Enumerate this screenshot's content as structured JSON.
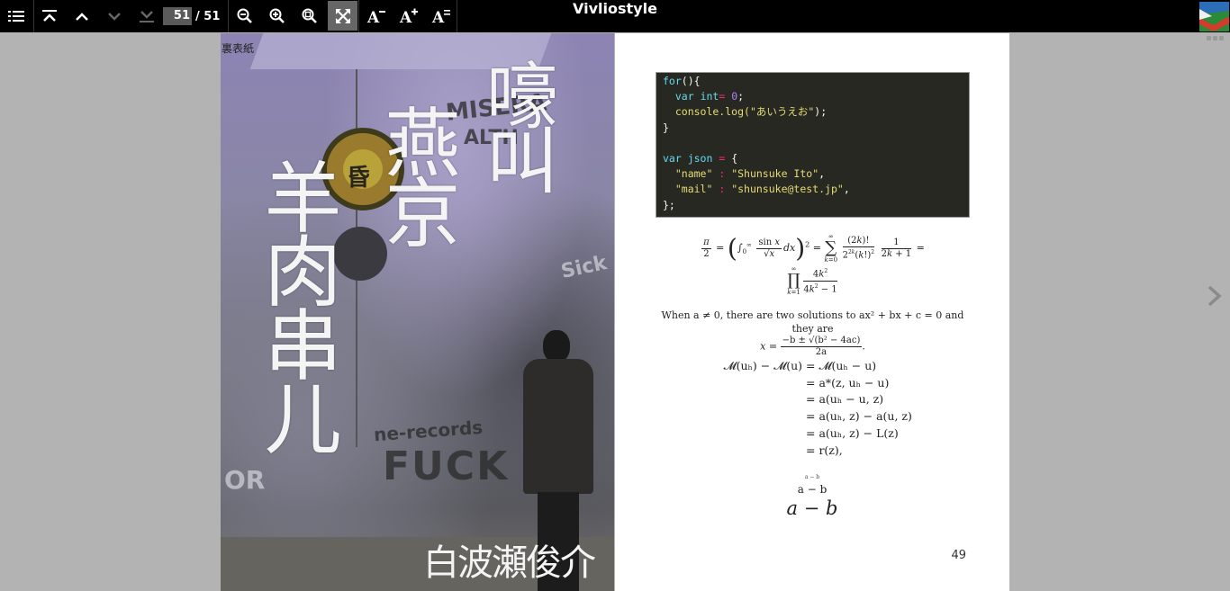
{
  "toolbar": {
    "title": "Vivliostyle",
    "current_page": "51",
    "total_pages": "/ 51",
    "buttons": [
      "table-of-contents",
      "first-page",
      "previous-page",
      "next-page",
      "last-page",
      "zoom-out",
      "zoom-in",
      "zoom-to-actual",
      "fit-to-screen",
      "font-size-decrease",
      "font-size-increase",
      "font-size-reset"
    ],
    "active_button": "fit-to-screen"
  },
  "cover": {
    "label": "裏表紙",
    "title_col1": "嚎叫",
    "title_col2": "燕京",
    "title_col3": "羊肉串儿",
    "author": "白波瀬俊介",
    "graffiti": [
      "MISERA",
      "ALTH",
      "Sick",
      "ne-records",
      "FUCK",
      "OR",
      "昏"
    ]
  },
  "content": {
    "code_lines": [
      [
        {
          "t": "for",
          "c": "kw"
        },
        {
          "t": "(){",
          "c": ""
        }
      ],
      [
        {
          "t": "  ",
          "c": ""
        },
        {
          "t": "var",
          "c": "kw"
        },
        {
          "t": " ",
          "c": ""
        },
        {
          "t": "int",
          "c": "kw"
        },
        {
          "t": "= ",
          "c": "op"
        },
        {
          "t": "0",
          "c": "num"
        },
        {
          "t": ";",
          "c": ""
        }
      ],
      [
        {
          "t": "  console.log(",
          "c": "yel"
        },
        {
          "t": "\"あいうえお\"",
          "c": "str"
        },
        {
          "t": ");",
          "c": ""
        }
      ],
      [
        {
          "t": "}",
          "c": ""
        }
      ],
      [
        {
          "t": "",
          "c": ""
        }
      ],
      [
        {
          "t": "var",
          "c": "kw"
        },
        {
          "t": " json ",
          "c": "kw"
        },
        {
          "t": "=",
          "c": "op"
        },
        {
          "t": " {",
          "c": ""
        }
      ],
      [
        {
          "t": "  ",
          "c": ""
        },
        {
          "t": "\"name\"",
          "c": "str"
        },
        {
          "t": " : ",
          "c": "op"
        },
        {
          "t": "\"Shunsuke Ito\"",
          "c": "str"
        },
        {
          "t": ",",
          "c": ""
        }
      ],
      [
        {
          "t": "  ",
          "c": ""
        },
        {
          "t": "\"mail\"",
          "c": "str"
        },
        {
          "t": " : ",
          "c": "op"
        },
        {
          "t": "\"shunsuke@test.jp\"",
          "c": "str"
        },
        {
          "t": ",",
          "c": ""
        }
      ],
      [
        {
          "t": "};",
          "c": ""
        }
      ]
    ],
    "prose_text": "When a ≠ 0, there are two solutions to ax² + bx + c = 0 and they are",
    "quadratic_prefix": "x =",
    "quadratic_num": "−b ± √(b² − 4ac)",
    "quadratic_den": "2a",
    "aligned_lhs": "𝓜(uₕ) − 𝓜(u)",
    "aligned_rhs": [
      "= 𝓜(uₕ − u)",
      "= a*(z, uₕ − u)",
      "= a(uₕ − u, z)",
      "= a(uₕ, z) − a(u, z)",
      "= a(uₕ, z) − L(z)",
      "= r(z),"
    ],
    "small_ab": "a − b",
    "mid_ab": "a − b",
    "big_ab": "a − b",
    "page_number": "49"
  }
}
